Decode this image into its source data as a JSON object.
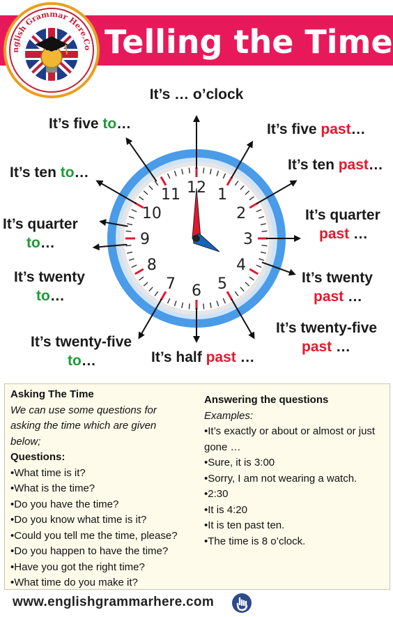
{
  "header": {
    "title": "Telling the Time",
    "logo_text": "English Grammar Here.Com"
  },
  "clock": {
    "numbers": [
      "12",
      "1",
      "2",
      "3",
      "4",
      "5",
      "6",
      "7",
      "8",
      "9",
      "10",
      "11"
    ],
    "hour": 4,
    "minute": 0,
    "labels": [
      {
        "key": "oclock",
        "parts": [
          {
            "t": "It’s … o’clock",
            "c": "dark"
          }
        ]
      },
      {
        "key": "five_past",
        "parts": [
          {
            "t": "It’s five ",
            "c": "dark"
          },
          {
            "t": "past",
            "c": "red"
          },
          {
            "t": "…",
            "c": "dark"
          }
        ]
      },
      {
        "key": "ten_past",
        "parts": [
          {
            "t": "It’s ten ",
            "c": "dark"
          },
          {
            "t": "past",
            "c": "red"
          },
          {
            "t": "…",
            "c": "dark"
          }
        ]
      },
      {
        "key": "quarter_past_1",
        "parts": [
          {
            "t": "It’s quarter",
            "c": "dark"
          }
        ]
      },
      {
        "key": "quarter_past_2",
        "parts": [
          {
            "t": "past",
            "c": "red"
          },
          {
            "t": " …",
            "c": "dark"
          }
        ]
      },
      {
        "key": "twenty_past_1",
        "parts": [
          {
            "t": "It’s twenty",
            "c": "dark"
          }
        ]
      },
      {
        "key": "twenty_past_2",
        "parts": [
          {
            "t": "past",
            "c": "red"
          },
          {
            "t": " …",
            "c": "dark"
          }
        ]
      },
      {
        "key": "twentyfive_past_1",
        "parts": [
          {
            "t": "It’s twenty-five",
            "c": "dark"
          }
        ]
      },
      {
        "key": "twentyfive_past_2",
        "parts": [
          {
            "t": "past",
            "c": "red"
          },
          {
            "t": " …",
            "c": "dark"
          }
        ]
      },
      {
        "key": "half_past",
        "parts": [
          {
            "t": "It’s half ",
            "c": "dark"
          },
          {
            "t": "past",
            "c": "red"
          },
          {
            "t": " …",
            "c": "dark"
          }
        ]
      },
      {
        "key": "twentyfive_to_1",
        "parts": [
          {
            "t": "It’s twenty-five",
            "c": "dark"
          }
        ]
      },
      {
        "key": "twentyfive_to_2",
        "parts": [
          {
            "t": "to",
            "c": "green"
          },
          {
            "t": "…",
            "c": "dark"
          }
        ]
      },
      {
        "key": "twenty_to_1",
        "parts": [
          {
            "t": "It’s twenty",
            "c": "dark"
          }
        ]
      },
      {
        "key": "twenty_to_2",
        "parts": [
          {
            "t": "to",
            "c": "green"
          },
          {
            "t": "…",
            "c": "dark"
          }
        ]
      },
      {
        "key": "quarter_to_1",
        "parts": [
          {
            "t": "It’s quarter",
            "c": "dark"
          }
        ]
      },
      {
        "key": "quarter_to_2",
        "parts": [
          {
            "t": "to",
            "c": "green"
          },
          {
            "t": "…",
            "c": "dark"
          }
        ]
      },
      {
        "key": "ten_to",
        "parts": [
          {
            "t": "It’s ten ",
            "c": "dark"
          },
          {
            "t": "to",
            "c": "green"
          },
          {
            "t": "…",
            "c": "dark"
          }
        ]
      },
      {
        "key": "five_to",
        "parts": [
          {
            "t": "It’s five ",
            "c": "dark"
          },
          {
            "t": "to",
            "c": "green"
          },
          {
            "t": "…",
            "c": "dark"
          }
        ]
      }
    ]
  },
  "asking": {
    "heading": "Asking The Time",
    "intro": [
      "We can use some questions for",
      "asking the time which are given",
      "below;"
    ],
    "questions_label": "Questions:",
    "questions": [
      "•What time is it?",
      "•What is the time?",
      "•Do you have the time?",
      "•Do you know what time is it?",
      "•Could you tell me the time, please?",
      "•Do you happen to have the time?",
      "•Have you got the right time?",
      "•What time do you make it?"
    ]
  },
  "answering": {
    "heading": "Answering the questions",
    "examples_label": "Examples:",
    "examples": [
      "•It’s exactly or about or almost or just",
      "gone …",
      "•Sure, it is 3:00",
      "•Sorry, I am not wearing a watch.",
      "•2:30",
      "•It is 4:20",
      "•It is ten past ten.",
      "•The time is 8 o’clock."
    ]
  },
  "footer": {
    "url": "www.englishgrammarhere.com",
    "icon": "hand-pointer-icon"
  },
  "colors": {
    "header": "#e8195a",
    "red": "#e3182d",
    "green": "#1f9a35",
    "dark": "#1a1a1a",
    "ring": "#4a9be8",
    "hour_hand": "#1565c0",
    "minute_hand": "#e3182d"
  }
}
